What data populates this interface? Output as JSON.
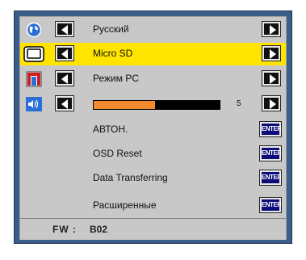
{
  "menu": {
    "rows": [
      {
        "label": "Русский",
        "icon": "language-icon"
      },
      {
        "label": "Micro SD",
        "icon": "screen-icon",
        "selected": true
      },
      {
        "label": "Режим PC",
        "icon": "pc-mode-icon"
      },
      {
        "label": "",
        "icon": "volume-icon",
        "slider_value": "5",
        "slider_fraction": 0.5
      }
    ],
    "actions": [
      {
        "label": "АВТОН.",
        "button": "ENTER"
      },
      {
        "label": "OSD Reset",
        "button": "ENTER"
      },
      {
        "label": "Data Transferring",
        "button": "ENTER"
      },
      {
        "label": "Расширенные",
        "button": "ENTER"
      }
    ]
  },
  "firmware": {
    "label": "FW :",
    "value": "B02"
  },
  "colors": {
    "frame": "#3b5d8a",
    "panel": "#c8c8c8",
    "selected": "#ffe400",
    "slider_fill": "#f28b30",
    "enter_button": "#0b0b7a"
  }
}
